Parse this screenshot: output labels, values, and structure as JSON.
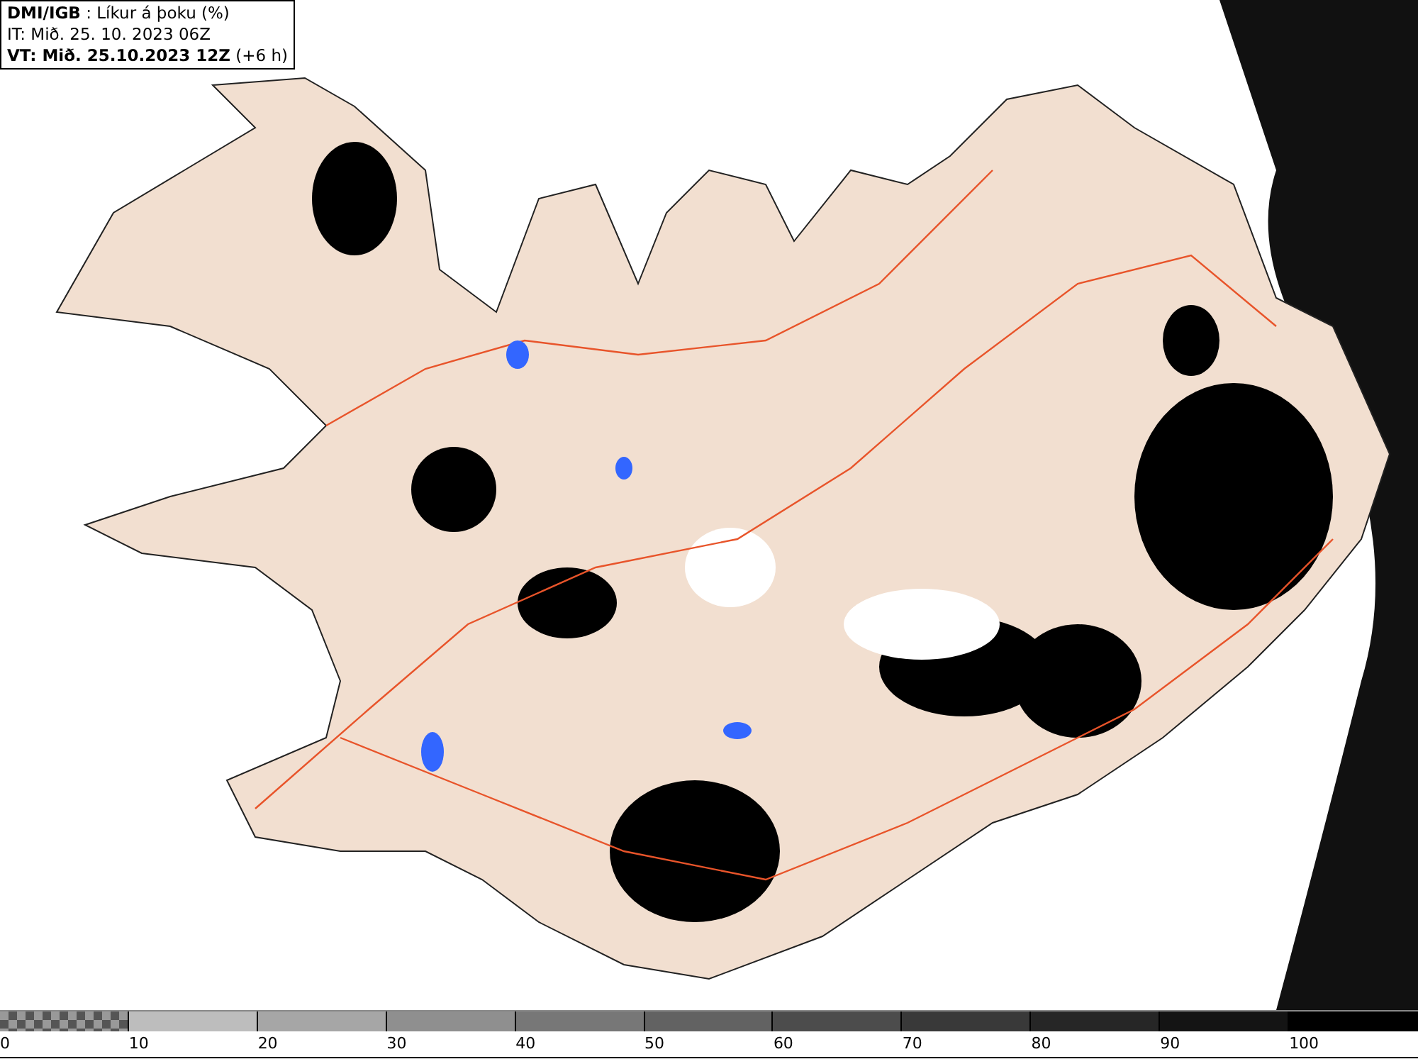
{
  "header": {
    "title": "**DMI/IGB** : Líkur á þoku (%)",
    "issued": "IT: Mið. 25. 10. 2023 06Z",
    "valid": "**VT: Mið. 25.10.2023 12Z** (+6 h)"
  },
  "legend": [
    {
      "label": "0",
      "kind": "checker"
    },
    {
      "label": "10",
      "color": "#bdbdbd",
      "kind": "solid"
    },
    {
      "label": "20",
      "color": "#a6a6a6",
      "kind": "solid"
    },
    {
      "label": "30",
      "color": "#8f8f8f",
      "kind": "solid"
    },
    {
      "label": "40",
      "color": "#777777",
      "kind": "solid"
    },
    {
      "label": "50",
      "color": "#626262",
      "kind": "solid"
    },
    {
      "label": "60",
      "color": "#4c4c4c",
      "kind": "solid"
    },
    {
      "label": "70",
      "color": "#393939",
      "kind": "solid"
    },
    {
      "label": "80",
      "color": "#262626",
      "kind": "solid"
    },
    {
      "label": "90",
      "color": "#141414",
      "kind": "solid"
    },
    {
      "label": "100",
      "color": "#000000",
      "kind": "solid"
    }
  ]
}
